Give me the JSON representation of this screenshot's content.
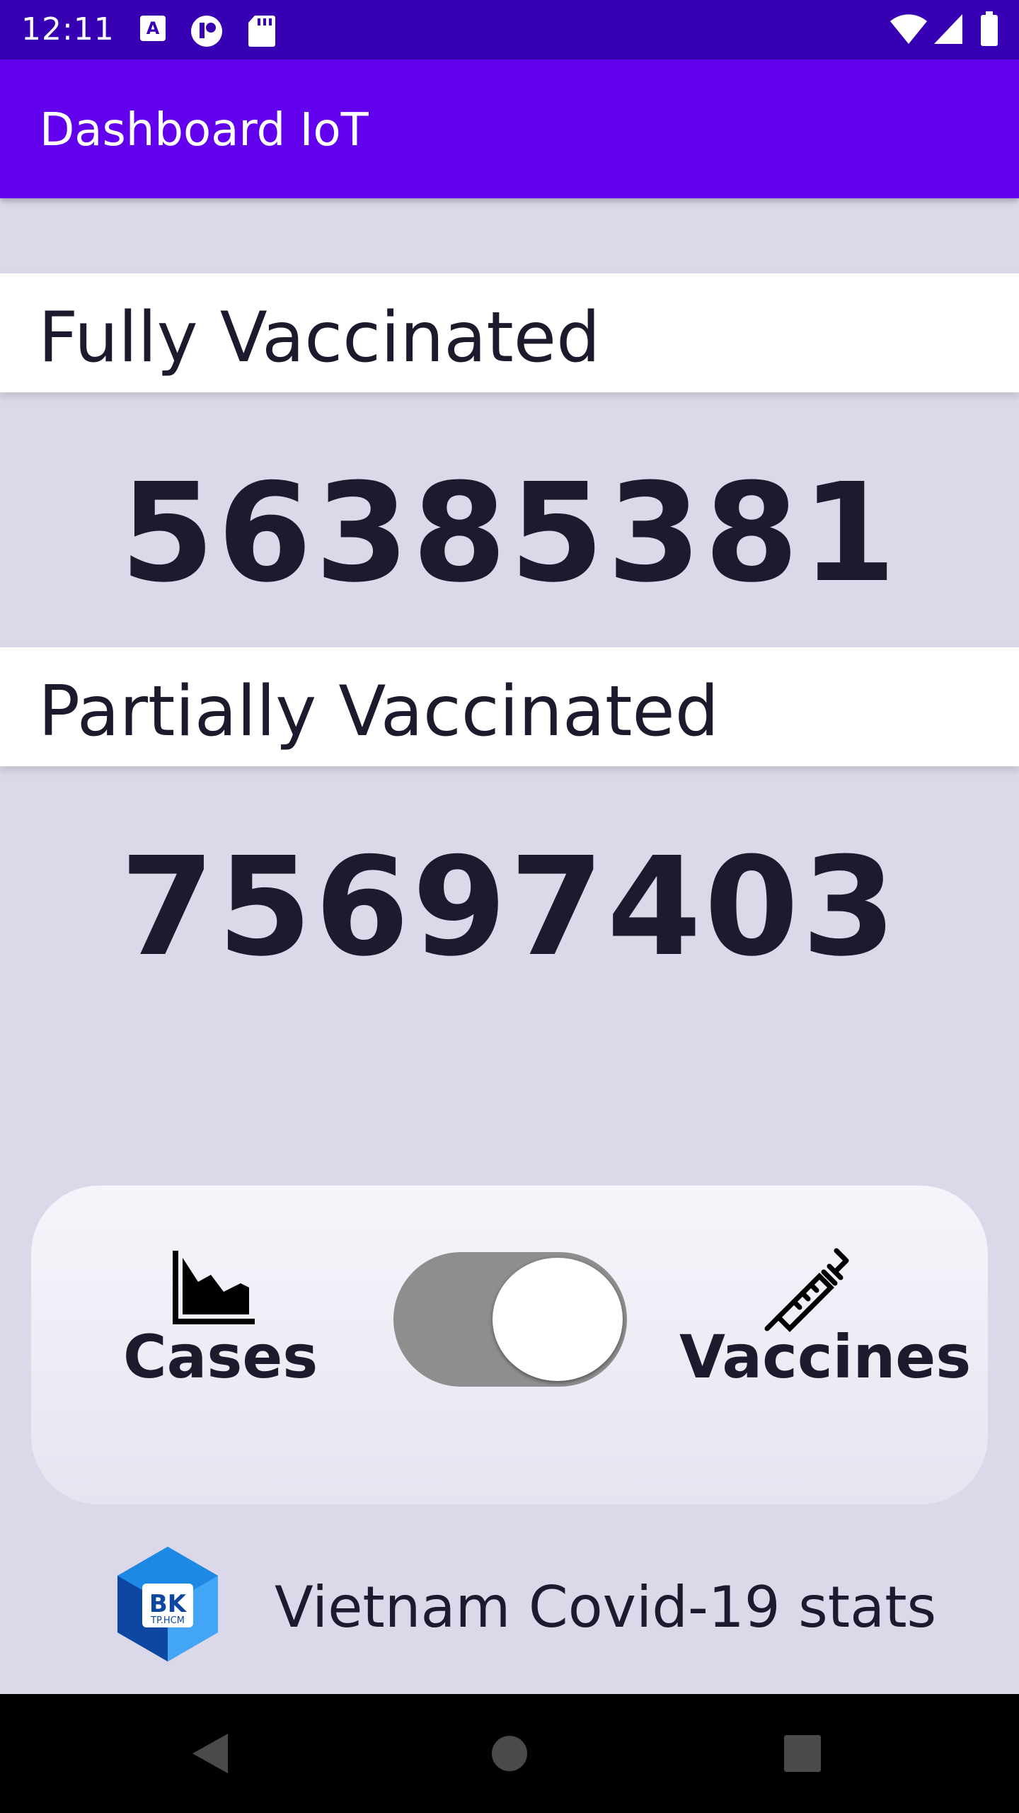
{
  "status_bar": {
    "time": "12:11",
    "left_icons": [
      "a-icon",
      "notification-icon",
      "sd-card-icon"
    ],
    "right_icons": [
      "wifi-icon",
      "signal-icon",
      "battery-icon"
    ]
  },
  "app_bar": {
    "title": "Dashboard IoT"
  },
  "fully_vaccinated": {
    "label": "Fully Vaccinated",
    "value": "56385381"
  },
  "partially_vaccinated": {
    "label": "Partially Vaccinated",
    "value": "75697403"
  },
  "toggle": {
    "left_label": "Cases",
    "right_label": "Vaccines",
    "left_icon": "area-chart-icon",
    "right_icon": "syringe-icon",
    "selected": "Vaccines"
  },
  "footer": {
    "text": "Vietnam Covid-19 stats",
    "logo_text": "BK",
    "logo_subtext": "TP.HCM"
  },
  "nav_bar": {
    "buttons": [
      "back-icon",
      "home-icon",
      "recents-icon"
    ]
  },
  "colors": {
    "status_bar": "#3700B3",
    "app_bar": "#6200EE",
    "background": "#DBD9E9",
    "switch_track": "#8E8E8E"
  }
}
